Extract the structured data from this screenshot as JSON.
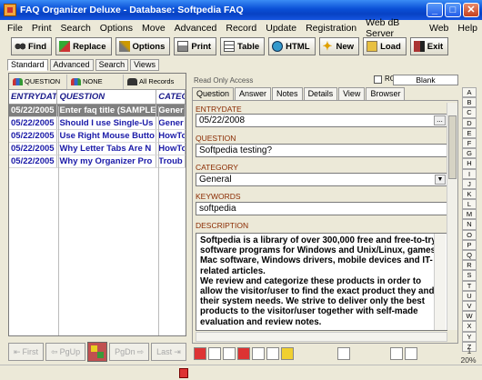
{
  "window": {
    "title": "FAQ Organizer Deluxe - Database: Softpedia FAQ"
  },
  "menu": [
    "File",
    "Print",
    "Search",
    "Options",
    "Move",
    "Advanced",
    "Record",
    "Update",
    "Registration",
    "Web dB Server",
    "Web",
    "Help"
  ],
  "toolbar": {
    "find": "Find",
    "replace": "Replace",
    "options": "Options",
    "print": "Print",
    "table": "Table",
    "html": "HTML",
    "new": "New",
    "load": "Load",
    "exit": "Exit"
  },
  "mode_tabs": [
    "Standard",
    "Advanced",
    "Search",
    "Views"
  ],
  "sort_buttons": [
    "QUESTION",
    "NONE",
    "All Records"
  ],
  "grid": {
    "headers": [
      "ENTRYDATE",
      "QUESTION",
      "CATEG"
    ],
    "rows": [
      [
        "05/22/2005",
        "Enter faq title (SAMPLE",
        "Gener"
      ],
      [
        "05/22/2005",
        "Should I use Single-Us",
        "Gener"
      ],
      [
        "05/22/2005",
        "Use Right Mouse Butto",
        "HowTo"
      ],
      [
        "05/22/2005",
        "Why Letter Tabs Are N",
        "HowTo"
      ],
      [
        "05/22/2005",
        "Why my Organizer Pro",
        "Troub"
      ]
    ]
  },
  "nav": {
    "first": "First",
    "pgup": "PgUp",
    "pgdn": "PgDn",
    "last": "Last"
  },
  "record_strip": {
    "readonly": "Read Only Access",
    "ro": "RO",
    "blank": "Blank"
  },
  "detail_tabs": [
    "Question",
    "Answer",
    "Notes",
    "Details",
    "View",
    "Browser"
  ],
  "fields": {
    "entrydate_label": "ENTRYDATE",
    "entrydate": "05/22/2008",
    "question_label": "QUESTION",
    "question": "Softpedia testing?",
    "category_label": "CATEGORY",
    "category": "General",
    "keywords_label": "KEYWORDS",
    "keywords": "softpedia",
    "description_label": "DESCRIPTION",
    "description_p1": "Softpedia is a library of over 300,000 free and free-to-try software programs for Windows and Unix/Linux, games, Mac software, Windows drivers, mobile devices and IT-related articles.",
    "description_p2": "We review and categorize these products in order to allow the visitor/user to find the exact product they and their system needs. We strive to deliver only the best products to the visitor/user together with self-made evaluation and review notes."
  },
  "alphabet": [
    "A",
    "B",
    "C",
    "D",
    "E",
    "F",
    "G",
    "H",
    "I",
    "J",
    "K",
    "L",
    "M",
    "N",
    "O",
    "P",
    "Q",
    "R",
    "S",
    "T",
    "U",
    "V",
    "W",
    "X",
    "Y",
    "Z"
  ],
  "status": {
    "page": "1",
    "zoom": "20%"
  },
  "colors": {
    "title_blue": "#0a4fd6",
    "row_text": "#1a1aa8",
    "field_label": "#8a2a00",
    "selected_row": "#7f7f7f"
  }
}
